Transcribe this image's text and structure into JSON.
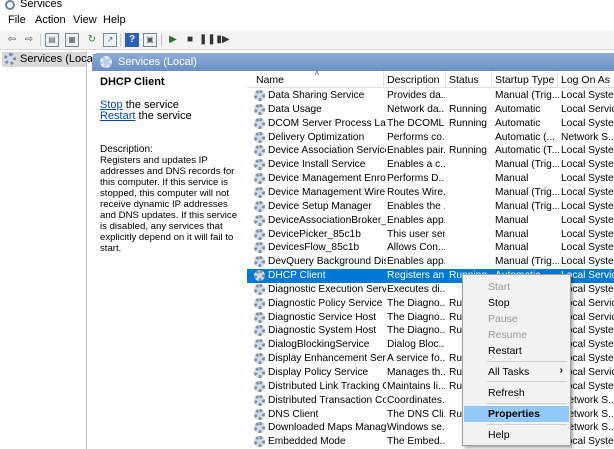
{
  "window": {
    "title": "Services"
  },
  "menu": [
    "File",
    "Action",
    "View",
    "Help"
  ],
  "toolbar": {
    "icons": [
      "back-arrow-icon",
      "forward-arrow-icon",
      "console-tree-icon",
      "properties-icon",
      "refresh-icon",
      "export-list-icon",
      "help-icon",
      "view-icon",
      "start-service-icon",
      "stop-service-icon",
      "pause-service-icon",
      "restart-service-icon"
    ]
  },
  "tree": {
    "root_label": "Services (Local)"
  },
  "panel_header": "Services (Local)",
  "details": {
    "service_name": "DHCP Client",
    "stop_link": "Stop",
    "stop_suffix": " the service",
    "restart_link": "Restart",
    "restart_suffix": " the service",
    "description_label": "Description:",
    "description": "Registers and updates IP addresses and DNS records for this computer. If this service is stopped, this computer will not receive dynamic IP addresses and DNS updates. If this service is disabled, any services that explicitly depend on it will fail to start."
  },
  "columns": [
    "Name",
    "Description",
    "Status",
    "Startup Type",
    "Log On As"
  ],
  "services": [
    {
      "name": "Data Sharing Service",
      "description": "Provides da...",
      "status": "",
      "startup": "Manual (Trig...",
      "logon": "Local Syste..."
    },
    {
      "name": "Data Usage",
      "description": "Network da...",
      "status": "Running",
      "startup": "Automatic",
      "logon": "Local Service"
    },
    {
      "name": "DCOM Server Process Laun...",
      "description": "The DCOML...",
      "status": "Running",
      "startup": "Automatic",
      "logon": "Local Syste..."
    },
    {
      "name": "Delivery Optimization",
      "description": "Performs co...",
      "status": "",
      "startup": "Automatic (...",
      "logon": "Network S..."
    },
    {
      "name": "Device Association Service",
      "description": "Enables pair...",
      "status": "Running",
      "startup": "Automatic (T...",
      "logon": "Local Syste..."
    },
    {
      "name": "Device Install Service",
      "description": "Enables a c...",
      "status": "",
      "startup": "Manual (Trig...",
      "logon": "Local Syste..."
    },
    {
      "name": "Device Management Enroll...",
      "description": "Performs D...",
      "status": "",
      "startup": "Manual",
      "logon": "Local Syste..."
    },
    {
      "name": "Device Management Wirele...",
      "description": "Routes Wire...",
      "status": "",
      "startup": "Manual (Trig...",
      "logon": "Local Syste..."
    },
    {
      "name": "Device Setup Manager",
      "description": "Enables the ...",
      "status": "",
      "startup": "Manual (Trig...",
      "logon": "Local Syste..."
    },
    {
      "name": "DeviceAssociationBroker_85...",
      "description": "Enables app...",
      "status": "",
      "startup": "Manual",
      "logon": "Local Syste..."
    },
    {
      "name": "DevicePicker_85c1b",
      "description": "This user ser...",
      "status": "",
      "startup": "Manual",
      "logon": "Local Syste..."
    },
    {
      "name": "DevicesFlow_85c1b",
      "description": "Allows Con...",
      "status": "",
      "startup": "Manual",
      "logon": "Local Syste..."
    },
    {
      "name": "DevQuery Background Disc...",
      "description": "Enables app...",
      "status": "",
      "startup": "Manual (Trig...",
      "logon": "Local Syste..."
    },
    {
      "name": "DHCP Client",
      "description": "Registers an...",
      "status": "Running",
      "startup": "Automatic",
      "logon": "Local Service"
    },
    {
      "name": "Diagnostic Execution Service",
      "description": "Executes di...",
      "status": "",
      "startup": "",
      "logon": "Local Syste..."
    },
    {
      "name": "Diagnostic Policy Service",
      "description": "The Diagno...",
      "status": "Run",
      "startup": "",
      "logon": "Local Service"
    },
    {
      "name": "Diagnostic Service Host",
      "description": "The Diagno...",
      "status": "Run",
      "startup": "",
      "logon": "Local Service"
    },
    {
      "name": "Diagnostic System Host",
      "description": "The Diagno...",
      "status": "Run",
      "startup": "",
      "logon": "Local Syste..."
    },
    {
      "name": "DialogBlockingService",
      "description": "Dialog Bloc...",
      "status": "",
      "startup": "",
      "logon": "Local Syste..."
    },
    {
      "name": "Display Enhancement Service",
      "description": "A service fo...",
      "status": "Run",
      "startup": "",
      "logon": "Local Syste..."
    },
    {
      "name": "Display Policy Service",
      "description": "Manages th...",
      "status": "Run",
      "startup": "",
      "logon": "Local Service"
    },
    {
      "name": "Distributed Link Tracking Cli...",
      "description": "Maintains li...",
      "status": "Run",
      "startup": "",
      "logon": "Local Syste..."
    },
    {
      "name": "Distributed Transaction Coo...",
      "description": "Coordinates...",
      "status": "",
      "startup": "",
      "logon": "Network S..."
    },
    {
      "name": "DNS Client",
      "description": "The DNS Cli...",
      "status": "Run",
      "startup": "",
      "logon": "Network S..."
    },
    {
      "name": "Downloaded Maps Manager",
      "description": "Windows se...",
      "status": "",
      "startup": "",
      "logon": "Network S..."
    },
    {
      "name": "Embedded Mode",
      "description": "The Embed...",
      "status": "",
      "startup": "",
      "logon": "Local Syste..."
    }
  ],
  "selected_index": 13,
  "context_menu": {
    "start": "Start",
    "stop": "Stop",
    "pause": "Pause",
    "resume": "Resume",
    "restart": "Restart",
    "all_tasks": "All Tasks",
    "refresh": "Refresh",
    "properties": "Properties",
    "help": "Help"
  }
}
